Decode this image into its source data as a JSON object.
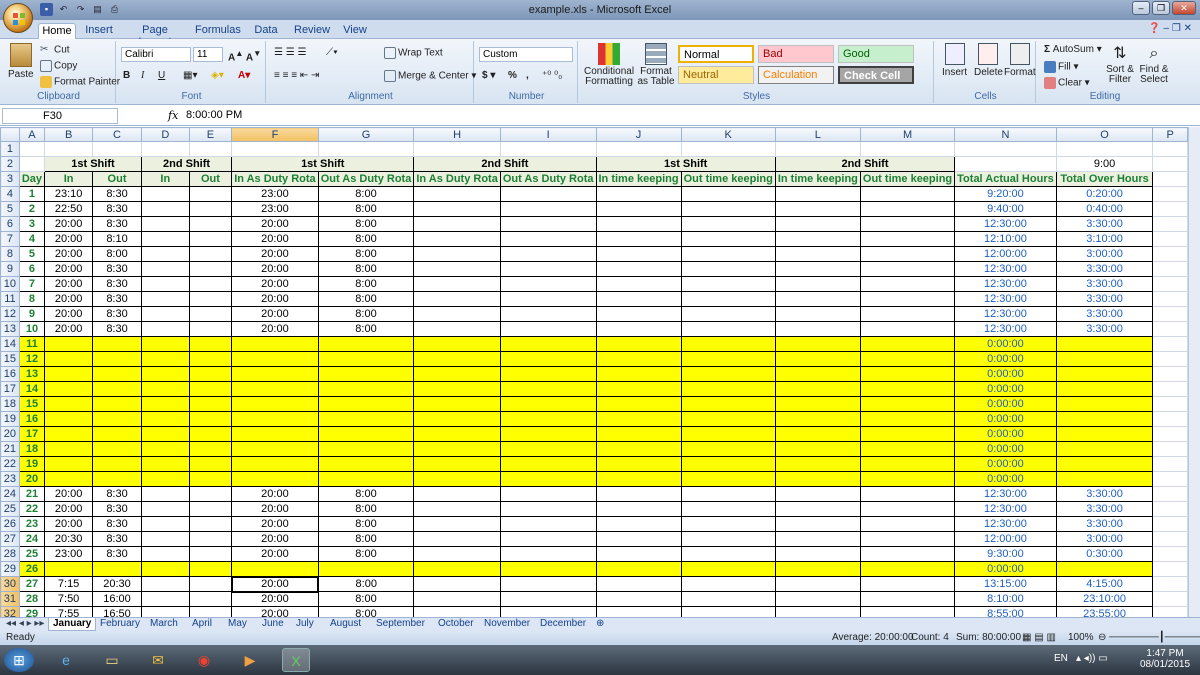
{
  "window": {
    "title": "example.xls - Microsoft Excel"
  },
  "ribbon_tabs": [
    "Home",
    "Insert",
    "Page Layout",
    "Formulas",
    "Data",
    "Review",
    "View"
  ],
  "clipboard": {
    "paste": "Paste",
    "cut": "Cut",
    "copy": "Copy",
    "format_painter": "Format Painter",
    "label": "Clipboard"
  },
  "font": {
    "name": "Calibri",
    "size": "11",
    "label": "Font"
  },
  "alignment": {
    "wrap": "Wrap Text",
    "merge": "Merge & Center",
    "label": "Alignment"
  },
  "number": {
    "format": "Custom",
    "currency": "$",
    "percent": "%",
    "comma": ",",
    "label": "Number"
  },
  "styles": {
    "conditional": "Conditional Formatting",
    "format_table": "Format as Table",
    "normal": "Normal",
    "bad": "Bad",
    "good": "Good",
    "neutral": "Neutral",
    "calculation": "Calculation",
    "check": "Check Cell",
    "label": "Styles"
  },
  "cells": {
    "insert": "Insert",
    "delete": "Delete",
    "format": "Format",
    "label": "Cells"
  },
  "editing": {
    "autosum": "AutoSum",
    "fill": "Fill",
    "clear": "Clear",
    "sort": "Sort & Filter",
    "find": "Find & Select",
    "label": "Editing"
  },
  "formula_bar": {
    "cell_ref": "F30",
    "fx": "fx",
    "value": "8:00:00 PM"
  },
  "columns": [
    "A",
    "B",
    "C",
    "D",
    "E",
    "F",
    "G",
    "H",
    "I",
    "J",
    "K",
    "L",
    "M",
    "N",
    "O",
    "P"
  ],
  "header_row2": [
    "1st Shift",
    "2nd Shift",
    "1st Shift",
    "2nd Shift",
    "1st Shift",
    "2nd Shift",
    "9:00"
  ],
  "header_row3": [
    "Day",
    "In",
    "Out",
    "In",
    "Out",
    "In As Duty Rota",
    "Out As Duty Rota",
    "In As Duty Rota",
    "Out As Duty Rota",
    "In time keeping",
    "Out time keeping",
    "In time keeping",
    "Out time keeping",
    "Total Actual Hours",
    "Total Over Hours"
  ],
  "rows": [
    {
      "r": "4",
      "day": "1",
      "in": "23:10",
      "out": "8:30",
      "f": "23:00",
      "g": "8:00",
      "n": "9:20:00",
      "o": "0:20:00",
      "y": false
    },
    {
      "r": "5",
      "day": "2",
      "in": "22:50",
      "out": "8:30",
      "f": "23:00",
      "g": "8:00",
      "n": "9:40:00",
      "o": "0:40:00",
      "y": false
    },
    {
      "r": "6",
      "day": "3",
      "in": "20:00",
      "out": "8:30",
      "f": "20:00",
      "g": "8:00",
      "n": "12:30:00",
      "o": "3:30:00",
      "y": false
    },
    {
      "r": "7",
      "day": "4",
      "in": "20:00",
      "out": "8:10",
      "f": "20:00",
      "g": "8:00",
      "n": "12:10:00",
      "o": "3:10:00",
      "y": false
    },
    {
      "r": "8",
      "day": "5",
      "in": "20:00",
      "out": "8:00",
      "f": "20:00",
      "g": "8:00",
      "n": "12:00:00",
      "o": "3:00:00",
      "y": false
    },
    {
      "r": "9",
      "day": "6",
      "in": "20:00",
      "out": "8:30",
      "f": "20:00",
      "g": "8:00",
      "n": "12:30:00",
      "o": "3:30:00",
      "y": false
    },
    {
      "r": "10",
      "day": "7",
      "in": "20:00",
      "out": "8:30",
      "f": "20:00",
      "g": "8:00",
      "n": "12:30:00",
      "o": "3:30:00",
      "y": false
    },
    {
      "r": "11",
      "day": "8",
      "in": "20:00",
      "out": "8:30",
      "f": "20:00",
      "g": "8:00",
      "n": "12:30:00",
      "o": "3:30:00",
      "y": false
    },
    {
      "r": "12",
      "day": "9",
      "in": "20:00",
      "out": "8:30",
      "f": "20:00",
      "g": "8:00",
      "n": "12:30:00",
      "o": "3:30:00",
      "y": false
    },
    {
      "r": "13",
      "day": "10",
      "in": "20:00",
      "out": "8:30",
      "f": "20:00",
      "g": "8:00",
      "n": "12:30:00",
      "o": "3:30:00",
      "y": false
    },
    {
      "r": "14",
      "day": "11",
      "in": "",
      "out": "",
      "f": "",
      "g": "",
      "n": "0:00:00",
      "o": "",
      "y": true
    },
    {
      "r": "15",
      "day": "12",
      "in": "",
      "out": "",
      "f": "",
      "g": "",
      "n": "0:00:00",
      "o": "",
      "y": true
    },
    {
      "r": "16",
      "day": "13",
      "in": "",
      "out": "",
      "f": "",
      "g": "",
      "n": "0:00:00",
      "o": "",
      "y": true
    },
    {
      "r": "17",
      "day": "14",
      "in": "",
      "out": "",
      "f": "",
      "g": "",
      "n": "0:00:00",
      "o": "",
      "y": true
    },
    {
      "r": "18",
      "day": "15",
      "in": "",
      "out": "",
      "f": "",
      "g": "",
      "n": "0:00:00",
      "o": "",
      "y": true
    },
    {
      "r": "19",
      "day": "16",
      "in": "",
      "out": "",
      "f": "",
      "g": "",
      "n": "0:00:00",
      "o": "",
      "y": true
    },
    {
      "r": "20",
      "day": "17",
      "in": "",
      "out": "",
      "f": "",
      "g": "",
      "n": "0:00:00",
      "o": "",
      "y": true
    },
    {
      "r": "21",
      "day": "18",
      "in": "",
      "out": "",
      "f": "",
      "g": "",
      "n": "0:00:00",
      "o": "",
      "y": true
    },
    {
      "r": "22",
      "day": "19",
      "in": "",
      "out": "",
      "f": "",
      "g": "",
      "n": "0:00:00",
      "o": "",
      "y": true
    },
    {
      "r": "23",
      "day": "20",
      "in": "",
      "out": "",
      "f": "",
      "g": "",
      "n": "0:00:00",
      "o": "",
      "y": true
    },
    {
      "r": "24",
      "day": "21",
      "in": "20:00",
      "out": "8:30",
      "f": "20:00",
      "g": "8:00",
      "n": "12:30:00",
      "o": "3:30:00",
      "y": false
    },
    {
      "r": "25",
      "day": "22",
      "in": "20:00",
      "out": "8:30",
      "f": "20:00",
      "g": "8:00",
      "n": "12:30:00",
      "o": "3:30:00",
      "y": false
    },
    {
      "r": "26",
      "day": "23",
      "in": "20:00",
      "out": "8:30",
      "f": "20:00",
      "g": "8:00",
      "n": "12:30:00",
      "o": "3:30:00",
      "y": false
    },
    {
      "r": "27",
      "day": "24",
      "in": "20:30",
      "out": "8:30",
      "f": "20:00",
      "g": "8:00",
      "n": "12:00:00",
      "o": "3:00:00",
      "y": false
    },
    {
      "r": "28",
      "day": "25",
      "in": "23:00",
      "out": "8:30",
      "f": "20:00",
      "g": "8:00",
      "n": "9:30:00",
      "o": "0:30:00",
      "y": false
    },
    {
      "r": "29",
      "day": "26",
      "in": "",
      "out": "",
      "f": "",
      "g": "",
      "n": "0:00:00",
      "o": "",
      "y": true
    },
    {
      "r": "30",
      "day": "27",
      "in": "7:15",
      "out": "20:30",
      "f": "20:00",
      "g": "8:00",
      "n": "13:15:00",
      "o": "4:15:00",
      "y": false
    },
    {
      "r": "31",
      "day": "28",
      "in": "7:50",
      "out": "16:00",
      "f": "20:00",
      "g": "8:00",
      "n": "8:10:00",
      "o": "23:10:00",
      "y": false
    },
    {
      "r": "32",
      "day": "29",
      "in": "7:55",
      "out": "16:50",
      "f": "20:00",
      "g": "8:00",
      "n": "8:55:00",
      "o": "23:55:00",
      "y": false
    }
  ],
  "sheet_tabs": [
    "January",
    "February",
    "March",
    "April",
    "May",
    "June",
    "July",
    "August",
    "September",
    "October",
    "November",
    "December"
  ],
  "status": {
    "ready": "Ready",
    "average": "Average: 20:00:00",
    "count": "Count: 4",
    "sum": "Sum: 80:00:00",
    "zoom": "100%"
  },
  "taskbar": {
    "lang": "EN",
    "time": "1:47 PM",
    "date": "08/01/2015"
  }
}
